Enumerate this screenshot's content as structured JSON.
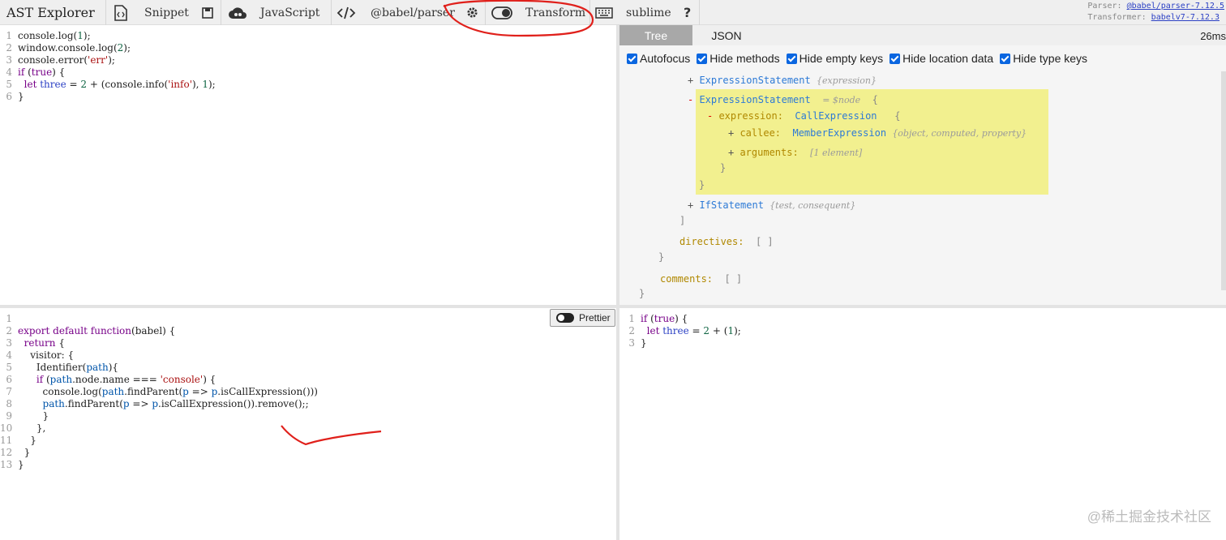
{
  "toolbar": {
    "title": "AST Explorer",
    "snippet": "Snippet",
    "language": "JavaScript",
    "parser": "@babel/parser",
    "transform": "Transform",
    "keymap": "sublime",
    "help": "?",
    "parser_label": "Parser:",
    "parser_version": "@babel/parser-7.12.5",
    "transformer_label": "Transformer:",
    "transformer_version": "babelv7-7.12.3"
  },
  "source_lines": [
    "1",
    "2",
    "3",
    "4",
    "5",
    "6"
  ],
  "right_panel": {
    "tab_tree": "Tree",
    "tab_json": "JSON",
    "time": "26ms",
    "options": [
      "Autofocus",
      "Hide methods",
      "Hide empty keys",
      "Hide location data",
      "Hide type keys"
    ]
  },
  "tree": {
    "node1": "ExpressionStatement",
    "node1_hint": "{expression}",
    "node2": "ExpressionStatement",
    "node2_hint": "= $node",
    "expression_key": "expression:",
    "expression_type": "CallExpression",
    "callee_key": "callee:",
    "callee_type": "MemberExpression",
    "callee_hint": "{object, computed, property}",
    "arguments_key": "arguments:",
    "arguments_hint": "[1 element]",
    "node3": "IfStatement",
    "node3_hint": "{test, consequent}",
    "directives_key": "directives:",
    "comments_key": "comments:"
  },
  "prettier_label": "Prettier",
  "watermark": "@稀土掘金技术社区"
}
